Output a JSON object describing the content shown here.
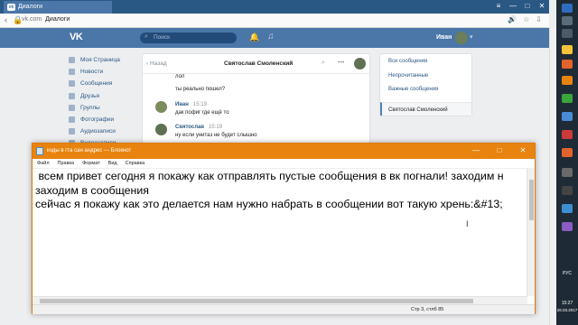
{
  "browser": {
    "tab_title": "Диалоги",
    "url_domain": "vk.com",
    "page_title": "Диалоги",
    "window_controls": [
      "—",
      "□",
      "✕"
    ]
  },
  "vk": {
    "logo": "VK",
    "search_placeholder": "Поиск",
    "username": "Иван"
  },
  "left_menu": [
    {
      "label": "Моя Страница"
    },
    {
      "label": "Новости"
    },
    {
      "label": "Сообщения"
    },
    {
      "label": "Друзья"
    },
    {
      "label": "Группы"
    },
    {
      "label": "Фотографии"
    },
    {
      "label": "Аудиозаписи"
    },
    {
      "label": "Видеозаписи"
    }
  ],
  "chat": {
    "back_label": "Назад",
    "title": "Святослав Смоленский",
    "messages": [
      {
        "text": "лол"
      },
      {
        "text": "ты реально пошел?"
      },
      {
        "name": "Иван",
        "time": "15:19",
        "text": "дак пофиг где ещё то"
      },
      {
        "name": "Святослав",
        "time": "15:19",
        "text": "ну если унитаз не будет слышно"
      }
    ]
  },
  "right_menu": [
    {
      "label": "Все сообщения"
    },
    {
      "label": "Непрочитанные"
    },
    {
      "label": "Важные сообщения"
    },
    {
      "label": "Святослав Смоленский"
    }
  ],
  "notepad": {
    "title": "коды в гта сан андрес — Блокнот",
    "menu": [
      "Файл",
      "Правка",
      "Формат",
      "Вид",
      "Справка"
    ],
    "lines": [
      " всем привет сегодня я покажу как отправлять пустые сообщения в вк погнали! заходим н",
      "заходим в сообщения",
      "сейчас я покажу как это делается нам нужно набрать в сообщении вот такую хрень:&#13;"
    ],
    "status": "Стр 3, стлб 85"
  },
  "taskbar": {
    "lang": "РУС",
    "time": "15:27",
    "date": "26.03.2017"
  }
}
